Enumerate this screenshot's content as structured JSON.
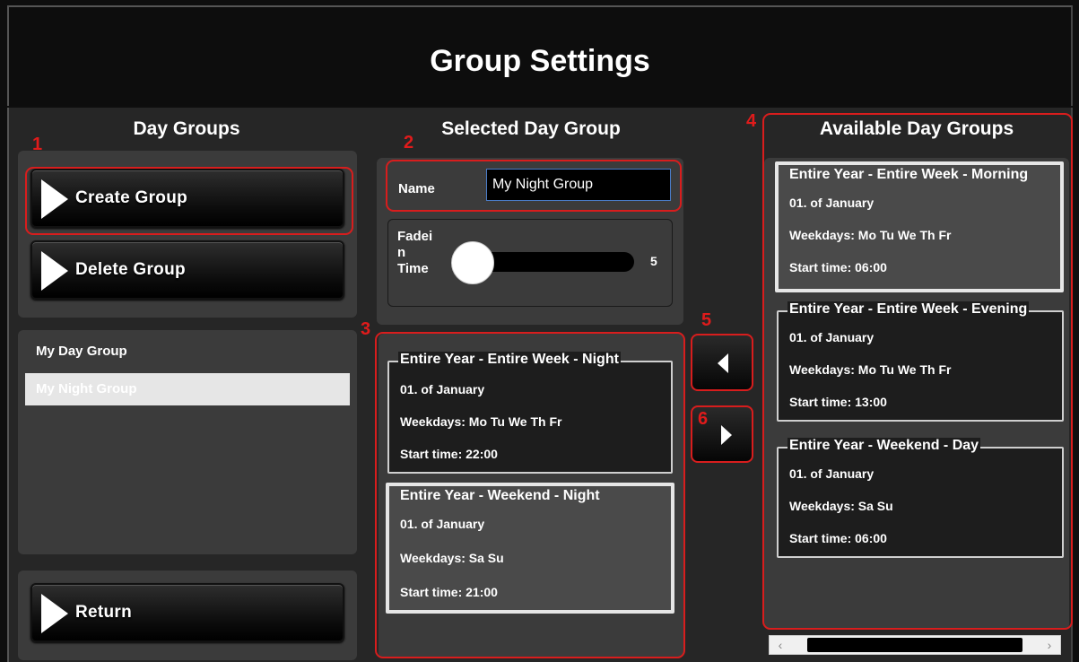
{
  "header": {
    "title": "Group Settings"
  },
  "day_groups": {
    "title": "Day Groups",
    "create_label": "Create Group",
    "delete_label": "Delete Group",
    "items": [
      {
        "label": "My Day Group",
        "selected": false
      },
      {
        "label": "My Night Group",
        "selected": true
      }
    ],
    "return_label": "Return"
  },
  "selected": {
    "title": "Selected Day Group",
    "name_label": "Name",
    "name_value": "My Night Group",
    "fade_label_1": "Fadei",
    "fade_label_2": "n",
    "fade_label_3": "Time",
    "fade_value": "5",
    "cards": [
      {
        "caption": "Entire Year - Entire Week - Night",
        "date": "01. of January",
        "weekdays": "Weekdays: Mo Tu We Th Fr",
        "start": "Start time: 22:00"
      },
      {
        "caption": "Entire Year - Weekend - Night",
        "date": "01. of January",
        "weekdays": "Weekdays: Sa Su",
        "start": "Start time: 21:00"
      }
    ]
  },
  "available": {
    "title": "Available Day Groups",
    "cards": [
      {
        "caption": "Entire Year - Entire Week - Morning",
        "date": "01. of January",
        "weekdays": "Weekdays: Mo Tu We Th Fr",
        "start": "Start time: 06:00"
      },
      {
        "caption": "Entire Year - Entire Week - Evening",
        "date": "01. of January",
        "weekdays": "Weekdays: Mo Tu We Th Fr",
        "start": "Start time: 13:00"
      },
      {
        "caption": "Entire Year - Weekend - Day",
        "date": "01. of January",
        "weekdays": "Weekdays: Sa Su",
        "start": "Start time: 06:00"
      }
    ]
  },
  "markers": [
    "1",
    "2",
    "3",
    "4",
    "5",
    "6"
  ],
  "icons": {
    "play": "play-triangle-icon",
    "left": "left-arrow-icon",
    "right": "right-arrow-icon"
  },
  "colors": {
    "marker": "#d81d1d",
    "selection": "#e6e6e6",
    "input_border": "#4a7cc8"
  }
}
